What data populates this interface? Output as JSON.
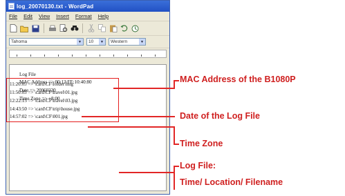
{
  "window": {
    "title": "log_20070130.txt - WordPad",
    "menu": [
      "File",
      "Edit",
      "View",
      "Insert",
      "Format",
      "Help"
    ],
    "font_name": "Tahoma",
    "font_size": "10",
    "script": "Western"
  },
  "document": {
    "heading": "Log File",
    "mac_line": "MAC Address => 00:13:FE:10:40:80",
    "date_line": "Date => 20060330",
    "tz_line": "Time Zone => +8:00",
    "log_entries": [
      "11:20:05 => \\card\\CF\\folder\\img",
      "11:50:03 => \\card\\CF\\travel\\01.jpg",
      "12:22:15 => \\card\\CF\\travel\\03.jpg",
      "14:43:50 => \\card\\CF\\trip\\house.jpg",
      "14:57:02 => \\card\\CF\\001.jpg"
    ]
  },
  "annotations": {
    "mac": "MAC Address of the B1080P",
    "date": "Date of the Log File",
    "tz": "Time Zone",
    "log_title": "Log File:",
    "log_detail": "Time/ Location/ Filename"
  },
  "colors": {
    "accent": "#e22626",
    "titlebar": "#2a5bd0"
  }
}
